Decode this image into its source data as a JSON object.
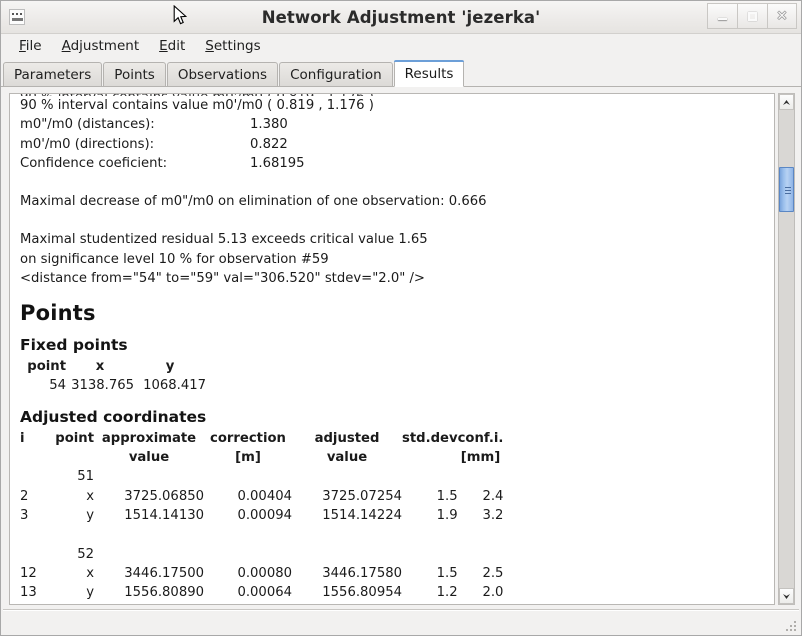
{
  "window": {
    "title": "Network Adjustment 'jezerka'",
    "app_icon": "window-icon",
    "controls": {
      "minimize": "minimize-icon",
      "maximize": "maximize-icon",
      "close": "✕"
    }
  },
  "menubar": {
    "items": [
      {
        "label": "File",
        "mnemonic": "F",
        "rest": "ile"
      },
      {
        "label": "Adjustment",
        "mnemonic": "A",
        "rest": "djustment"
      },
      {
        "label": "Edit",
        "mnemonic": "E",
        "rest": "dit"
      },
      {
        "label": "Settings",
        "mnemonic": "S",
        "rest": "ettings"
      }
    ]
  },
  "tabs": {
    "active": "Results",
    "items": [
      {
        "label": "Parameters",
        "active": false
      },
      {
        "label": "Points",
        "active": false
      },
      {
        "label": "Observations",
        "active": false
      },
      {
        "label": "Configuration",
        "active": false
      },
      {
        "label": "Results",
        "active": true
      }
    ]
  },
  "report": {
    "stats": {
      "interval_line": "90 % interval contains value m0'/m0 ( 0.819 , 1.176 )",
      "rows": [
        {
          "key": "m0\"/m0 (distances):",
          "value": "1.380"
        },
        {
          "key": "m0'/m0 (directions):",
          "value": "0.822"
        },
        {
          "key": "Confidence coeficient:",
          "value": "1.68195"
        }
      ],
      "max_decrease_line": "Maximal decrease of m0\"/m0 on elimination of one observation: 0.666",
      "residual_line_1": "Maximal studentized residual 5.13 exceeds critical value 1.65",
      "residual_line_2": "on significance level 10 % for observation #59",
      "residual_line_3": "<distance from=\"54\" to=\"59\" val=\"306.520\" stdev=\"2.0\" />"
    },
    "points_heading": "Points",
    "fixed_points": {
      "heading": "Fixed points",
      "headers": [
        "point",
        "x",
        "y"
      ],
      "rows": [
        [
          "54",
          "3138.765",
          "1068.417"
        ]
      ]
    },
    "adjusted_coordinates": {
      "heading": "Adjusted coordinates",
      "headers_row1": [
        "i",
        "point",
        "approximate",
        "correction",
        "adjusted",
        "std.dev",
        "conf.i."
      ],
      "headers_row2": [
        "",
        "",
        "value",
        "[m]",
        "value",
        "",
        "[mm]"
      ],
      "groups": [
        {
          "point": "51",
          "rows": [
            {
              "i": "2",
              "axis": "x",
              "approximate": "3725.06850",
              "correction": "0.00404",
              "adjusted": "3725.07254",
              "stddev": "1.5",
              "confi": "2.4"
            },
            {
              "i": "3",
              "axis": "y",
              "approximate": "1514.14130",
              "correction": "0.00094",
              "adjusted": "1514.14224",
              "stddev": "1.9",
              "confi": "3.2"
            }
          ]
        },
        {
          "point": "52",
          "rows": [
            {
              "i": "12",
              "axis": "x",
              "approximate": "3446.17500",
              "correction": "0.00080",
              "adjusted": "3446.17580",
              "stddev": "1.5",
              "confi": "2.5"
            },
            {
              "i": "13",
              "axis": "y",
              "approximate": "1556.80890",
              "correction": "0.00064",
              "adjusted": "1556.80954",
              "stddev": "1.2",
              "confi": "2.0"
            }
          ]
        }
      ]
    }
  },
  "scrollbar": {
    "up_arrow": "scroll-up-icon",
    "down_arrow": "scroll-down-icon",
    "thumb_color": "#9cc0ec",
    "thumb_top_pct": 13,
    "thumb_height_pct": 10
  },
  "colors": {
    "accent": "#6c9fd8",
    "window_bg": "#f2f1f0",
    "content_bg": "#ffffff",
    "text": "#1b1b1b"
  }
}
